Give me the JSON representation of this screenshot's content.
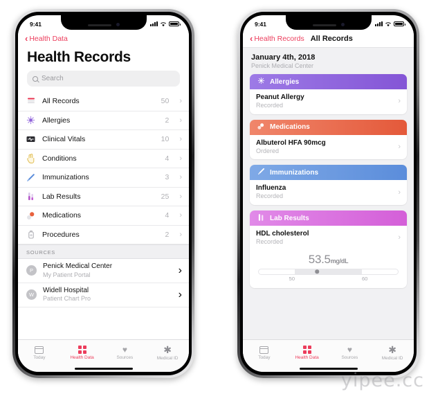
{
  "watermark": "yipee.cc",
  "left_phone": {
    "status": {
      "time": "9:41",
      "signal_icon": "signal-bars-icon",
      "wifi_icon": "wifi-icon",
      "battery_icon": "battery-icon"
    },
    "nav": {
      "back_label": "Health Data"
    },
    "title": "Health Records",
    "search": {
      "placeholder": "Search",
      "icon": "search-icon"
    },
    "records": [
      {
        "icon": "all-records-icon",
        "label": "All Records",
        "count": "50",
        "color": "#e8334f"
      },
      {
        "icon": "allergies-icon",
        "label": "Allergies",
        "count": "2",
        "color": "#8f62d8"
      },
      {
        "icon": "clinical-vitals-icon",
        "label": "Clinical Vitals",
        "count": "10",
        "color": "#2b2b30"
      },
      {
        "icon": "conditions-icon",
        "label": "Conditions",
        "count": "4",
        "color": "#e8c96a"
      },
      {
        "icon": "immunizations-icon",
        "label": "Immunizations",
        "count": "3",
        "color": "#5b8ddb"
      },
      {
        "icon": "lab-results-icon",
        "label": "Lab Results",
        "count": "25",
        "color": "#c45fd4"
      },
      {
        "icon": "medications-icon",
        "label": "Medications",
        "count": "4",
        "color": "#e8613d"
      },
      {
        "icon": "procedures-icon",
        "label": "Procedures",
        "count": "2",
        "color": "#a0a0a6"
      }
    ],
    "sources_header": "SOURCES",
    "sources": [
      {
        "initial": "P",
        "name": "Penick Medical Center",
        "sub": "My Patient Portal"
      },
      {
        "initial": "W",
        "name": "Widell Hospital",
        "sub": "Patient Chart Pro"
      }
    ]
  },
  "right_phone": {
    "status": {
      "time": "9:41",
      "signal_icon": "signal-bars-icon",
      "wifi_icon": "wifi-icon",
      "battery_icon": "battery-icon"
    },
    "nav": {
      "back_label": "Health Records",
      "title": "All Records"
    },
    "date": {
      "main": "January 4th, 2018",
      "sub": "Penick Medical Center"
    },
    "cards": [
      {
        "header": "Allergies",
        "icon": "allergy-burst-icon",
        "color_from": "#9d7ae6",
        "color_to": "#8455d6",
        "item_title": "Peanut Allergy",
        "item_sub": "Recorded"
      },
      {
        "header": "Medications",
        "icon": "pills-icon",
        "color_from": "#f0866b",
        "color_to": "#e4593a",
        "item_title": "Albuterol HFA 90mcg",
        "item_sub": "Ordered"
      },
      {
        "header": "Immunizations",
        "icon": "syringe-icon",
        "color_from": "#7fa9e6",
        "color_to": "#5b8ddb",
        "item_title": "Influenza",
        "item_sub": "Recorded"
      },
      {
        "header": "Lab Results",
        "icon": "test-tubes-icon",
        "color_from": "#e18ae8",
        "color_to": "#d45fd8",
        "item_title": "HDL cholesterol",
        "item_sub": "Recorded",
        "measurement": {
          "value": "53.5",
          "unit": "mg/dL",
          "range_low": "50",
          "range_high": "60"
        }
      }
    ]
  },
  "tabbar": {
    "tabs": [
      {
        "label": "Today",
        "icon": "today-calendar-icon",
        "active": false
      },
      {
        "label": "Health Data",
        "icon": "health-grid-icon",
        "active": true
      },
      {
        "label": "Sources",
        "icon": "heart-icon",
        "active": false
      },
      {
        "label": "Medical ID",
        "icon": "asterisk-icon",
        "active": false
      }
    ]
  }
}
